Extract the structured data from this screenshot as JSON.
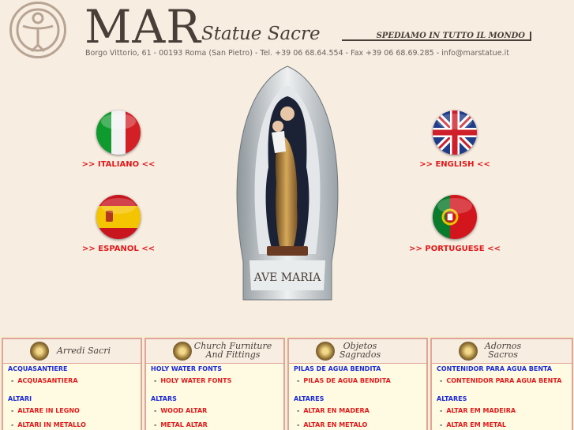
{
  "header": {
    "brand": "MAR",
    "subtitle": "Statue Sacre",
    "shipping": "SPEDIAMO IN TUTTO IL MONDO",
    "address": "Borgo Vittorio, 61 - 00193 Roma (San Pietro) - Tel. +39 06 68.64.554 - Fax +39 06 68.69.285 - info@marstatue.it"
  },
  "languages": [
    {
      "label": ">> ITALIANO <<"
    },
    {
      "label": ">> ENGLISH <<"
    },
    {
      "label": ">> ESPANOL <<"
    },
    {
      "label": ">> PORTUGUESE <<"
    }
  ],
  "statue": {
    "caption": "AVE MARIA"
  },
  "columns": [
    {
      "title_lines": [
        "Arredi Sacri"
      ],
      "sections": [
        {
          "heading": "ACQUASANTIERE",
          "items": [
            "ACQUASANTIERA"
          ]
        },
        {
          "heading": "ALTARI",
          "items": [
            "ALTARE IN LEGNO",
            "ALTARI IN METALLO"
          ]
        }
      ]
    },
    {
      "title_lines": [
        "Church Furniture",
        "And Fittings"
      ],
      "sections": [
        {
          "heading": "HOLY WATER FONTS",
          "items": [
            "HOLY WATER FONTS"
          ]
        },
        {
          "heading": "ALTARS",
          "items": [
            "WOOD ALTAR",
            "METAL ALTAR"
          ]
        }
      ]
    },
    {
      "title_lines": [
        "Objetos",
        "Sagrados"
      ],
      "sections": [
        {
          "heading": "PILAS DE AGUA BENDITA",
          "items": [
            "PILAS DE AGUA BENDITA"
          ]
        },
        {
          "heading": "ALTARES",
          "items": [
            "ALTAR EN MADERA",
            "ALTAR EN METALO"
          ]
        }
      ]
    },
    {
      "title_lines": [
        "Adornos",
        "Sacros"
      ],
      "sections": [
        {
          "heading": "CONTENIDOR PARA AGUA BENTA",
          "items": [
            "CONTENIDOR PARA AGUA BENTA"
          ]
        },
        {
          "heading": "ALTARES",
          "items": [
            "ALTAR EM MADEIRA",
            "ALTAR EM METAL"
          ]
        }
      ]
    }
  ]
}
